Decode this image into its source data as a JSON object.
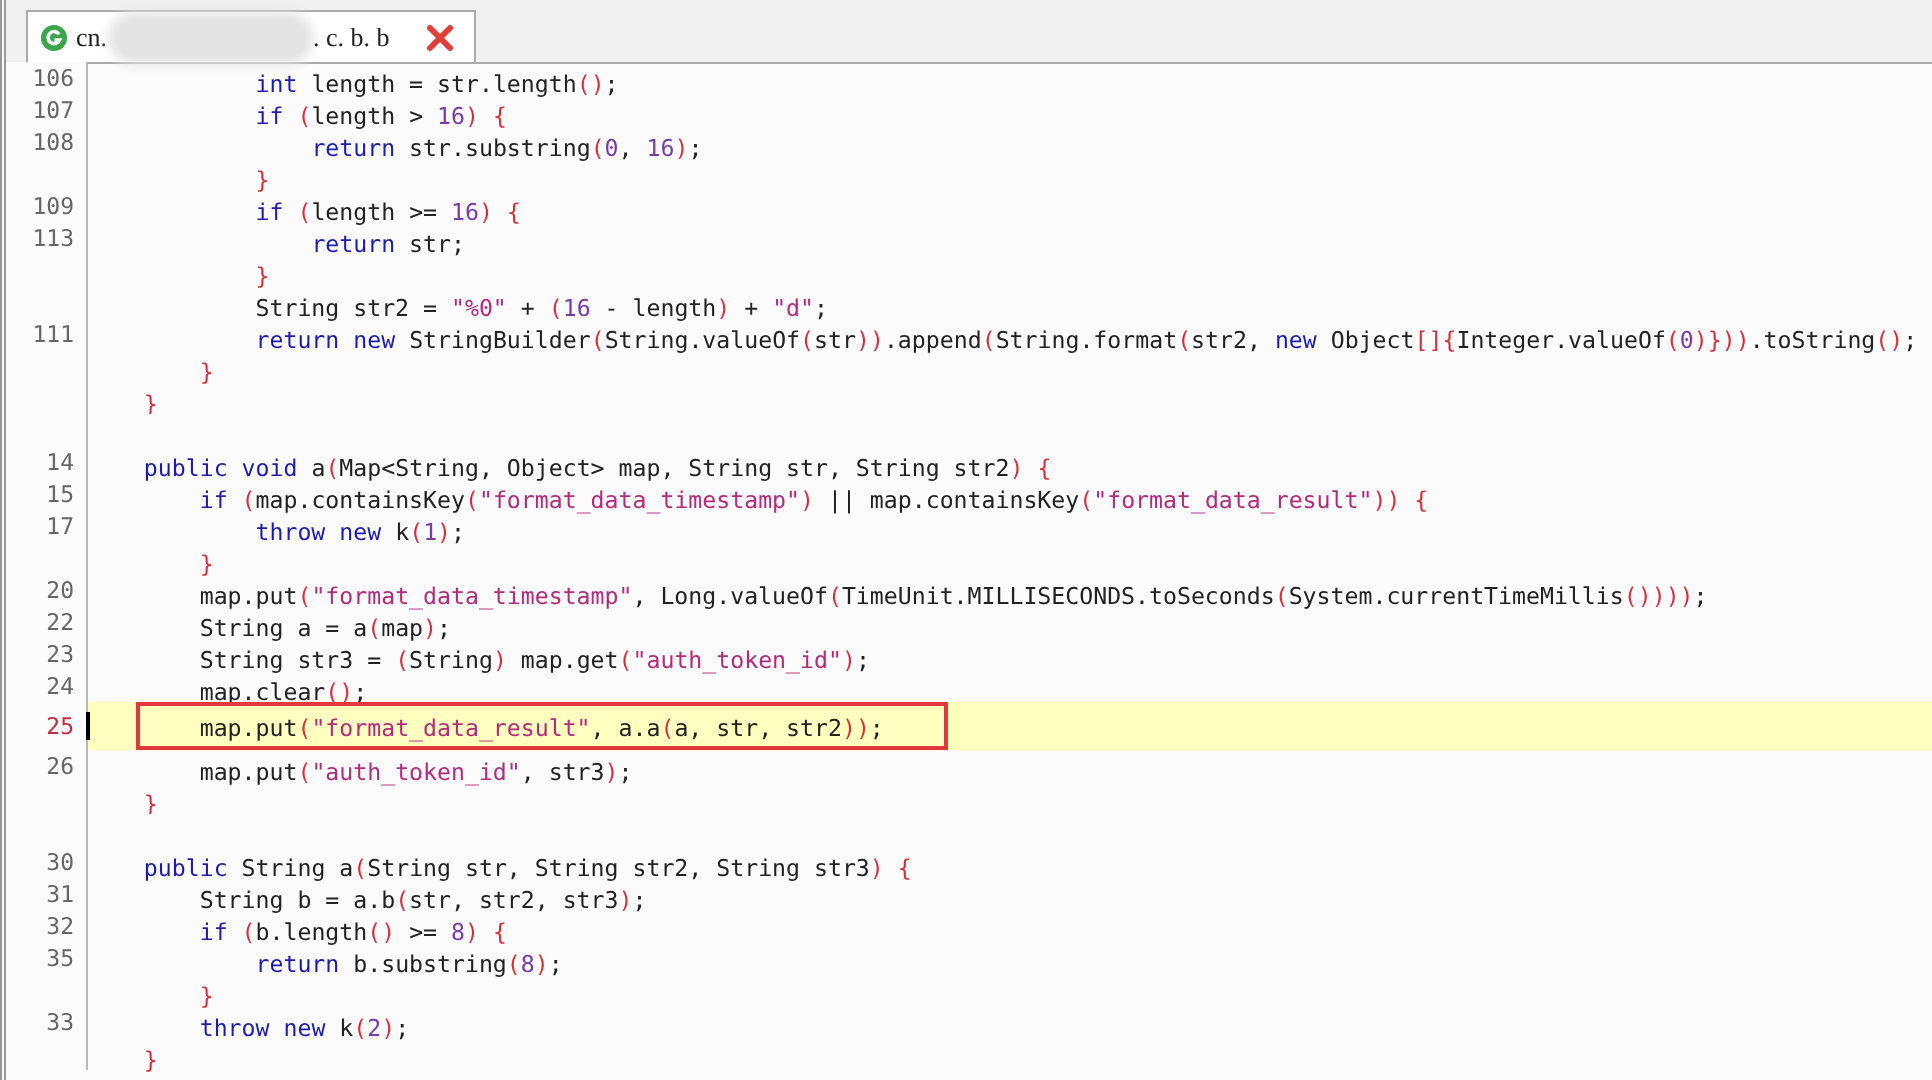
{
  "tab": {
    "label_start": "cn.",
    "label_end": ". c. b. b",
    "selected": true,
    "redacted": true
  },
  "lines": [
    {
      "kind": "code",
      "number": "106",
      "code": "            int length = str.length();"
    },
    {
      "kind": "code",
      "number": "107",
      "code": "            if (length > 16) {"
    },
    {
      "kind": "code",
      "number": "108",
      "code": "                return str.substring(0, 16);"
    },
    {
      "kind": "code",
      "code": "            }"
    },
    {
      "kind": "code",
      "number": "109",
      "code": "            if (length >= 16) {"
    },
    {
      "kind": "code",
      "number": "113",
      "code": "                return str;"
    },
    {
      "kind": "code",
      "code": "            }"
    },
    {
      "kind": "code",
      "code": "            String str2 = \"%0\" + (16 - length) + \"d\";"
    },
    {
      "kind": "code",
      "number": "111",
      "code": "            return new StringBuilder(String.valueOf(str)).append(String.format(str2, new Object[]{Integer.valueOf(0)})).toString();"
    },
    {
      "kind": "code",
      "code": "        }"
    },
    {
      "kind": "code",
      "code": "    }"
    },
    {
      "kind": "blank"
    },
    {
      "kind": "code",
      "number": "14",
      "code": "    public void a(Map<String, Object> map, String str, String str2) {"
    },
    {
      "kind": "code",
      "number": "15",
      "code": "        if (map.containsKey(\"format_data_timestamp\") || map.containsKey(\"format_data_result\")) {"
    },
    {
      "kind": "code",
      "number": "17",
      "code": "            throw new k(1);"
    },
    {
      "kind": "code",
      "code": "        }"
    },
    {
      "kind": "code",
      "number": "20",
      "code": "        map.put(\"format_data_timestamp\", Long.valueOf(TimeUnit.MILLISECONDS.toSeconds(System.currentTimeMillis())));"
    },
    {
      "kind": "code",
      "number": "22",
      "code": "        String a = a(map);"
    },
    {
      "kind": "code",
      "number": "23",
      "code": "        String str3 = (String) map.get(\"auth_token_id\");"
    },
    {
      "kind": "code",
      "number": "24",
      "code": "        map.clear();"
    },
    {
      "kind": "code",
      "number": "25",
      "code": "        map.put(\"format_data_result\", a.a(a, str, str2));",
      "current": true,
      "boxed": true
    },
    {
      "kind": "code",
      "number": "26",
      "code": "        map.put(\"auth_token_id\", str3);"
    },
    {
      "kind": "code",
      "code": "    }"
    },
    {
      "kind": "blank"
    },
    {
      "kind": "code",
      "number": "30",
      "code": "    public String a(String str, String str2, String str3) {"
    },
    {
      "kind": "code",
      "number": "31",
      "code": "        String b = a.b(str, str2, str3);"
    },
    {
      "kind": "code",
      "number": "32",
      "code": "        if (b.length() >= 8) {"
    },
    {
      "kind": "code",
      "number": "35",
      "code": "            return b.substring(8);"
    },
    {
      "kind": "code",
      "code": "        }"
    },
    {
      "kind": "code",
      "number": "33",
      "code": "        throw new k(2);"
    },
    {
      "kind": "code",
      "code": "    }"
    }
  ]
}
